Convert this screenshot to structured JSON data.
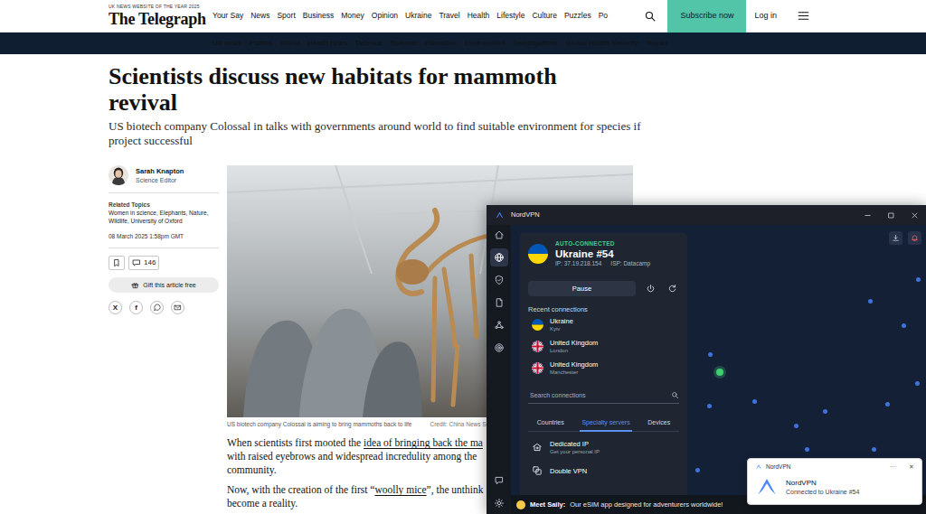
{
  "masthead": {
    "award": "UK NEWS WEBSITE OF THE YEAR 2025",
    "logo": "The Telegraph"
  },
  "top_nav": [
    "Your Say",
    "News",
    "Sport",
    "Business",
    "Money",
    "Opinion",
    "Ukraine",
    "Travel",
    "Health",
    "Lifestyle",
    "Culture",
    "Puzzles",
    "Po"
  ],
  "header_actions": {
    "subscribe": "Subscribe now",
    "login": "Log in"
  },
  "section_nav": [
    "UK news",
    "Politics",
    "World",
    "Health news",
    "Defence",
    "Science",
    "Education",
    "Environment",
    "Investigations",
    "Global Health Security",
    "Royals"
  ],
  "article": {
    "title": "Scientists discuss new habitats for mammoth revival",
    "standfirst": "US biotech company Colossal in talks with governments around world to find suitable environment for species if project successful",
    "author": {
      "name": "Sarah Knapton",
      "role": "Science Editor"
    },
    "related_topics": {
      "label": "Related Topics",
      "text": "Women in science, Elephants, Nature, Wildlife, University of Oxford"
    },
    "date": "08 March 2025 1:58pm GMT",
    "comments": "146",
    "gift": "Gift this article free",
    "share": [
      {
        "kind": "text",
        "label": "X"
      },
      {
        "kind": "text",
        "label": "f"
      },
      {
        "kind": "whatsapp"
      },
      {
        "kind": "mail"
      }
    ],
    "image": {
      "caption": "US biotech company Colossal is aiming to bring mammoths back to life",
      "credit": "Credit: China News Se"
    },
    "body": [
      [
        [
          {
            "text": "When scientists first mooted the ",
            "link": false
          },
          {
            "text": "idea of bringing back the ma",
            "link": true
          }
        ],
        [
          {
            "text": "with raised eyebrows and widespread incredulity among the",
            "link": false
          }
        ],
        [
          {
            "text": "community.",
            "link": false
          }
        ]
      ],
      [
        [
          {
            "text": "Now, with the creation of the first “",
            "link": false
          },
          {
            "text": "woolly mice",
            "link": true
          },
          {
            "text": "”, the unthink",
            "link": false
          }
        ],
        [
          {
            "text": "become a reality.",
            "link": false
          }
        ]
      ]
    ]
  },
  "vpn": {
    "title": "NordVPN",
    "rail": {
      "top": [
        {
          "selected": false
        },
        {
          "selected": true
        },
        {
          "selected": false
        },
        {
          "selected": false
        },
        {
          "selected": false
        },
        {
          "selected": false
        }
      ],
      "bottom": [
        {
          "selected": false
        },
        {
          "selected": false
        }
      ]
    },
    "status": "AUTO-CONNECTED",
    "server": "Ukraine #54",
    "ip": "IP: 37.19.218.154",
    "isp": "ISP: Datacamp",
    "pause": "Pause",
    "recent_label": "Recent connections",
    "recent": [
      {
        "country": "Ukraine",
        "city": "Kyiv",
        "kind": "ua"
      },
      {
        "country": "United Kingdom",
        "city": "London",
        "kind": "uk"
      },
      {
        "country": "United Kingdom",
        "city": "Manchester",
        "kind": "uk"
      }
    ],
    "search": "Search connections",
    "tabs": [
      {
        "label": "Countries",
        "selected": false
      },
      {
        "label": "Specialty servers",
        "selected": true
      },
      {
        "label": "Devices",
        "selected": false
      }
    ],
    "specialty": [
      {
        "title": "Dedicated IP",
        "subtitle": "Get your personal IP",
        "kind": "dedicated"
      },
      {
        "title": "Double VPN",
        "kind": "double"
      }
    ],
    "map_pins": [
      {
        "connected": false
      },
      {
        "connected": false
      },
      {
        "connected": false
      },
      {
        "connected": false
      },
      {
        "connected": true
      },
      {
        "connected": false
      },
      {
        "connected": false
      },
      {
        "connected": false
      },
      {
        "connected": false
      },
      {
        "connected": false
      },
      {
        "connected": false
      },
      {
        "connected": false
      },
      {
        "connected": false
      },
      {
        "connected": false
      },
      {
        "connected": false
      },
      {
        "connected": false
      }
    ],
    "banner": {
      "lead": "Meet Saily:",
      "text": "Our eSIM app designed for adventurers worldwide!"
    }
  },
  "toast": {
    "app": "NordVPN",
    "menu": "···",
    "close": "✕",
    "title": "NordVPN",
    "message": "Connected to Ukraine #54"
  }
}
